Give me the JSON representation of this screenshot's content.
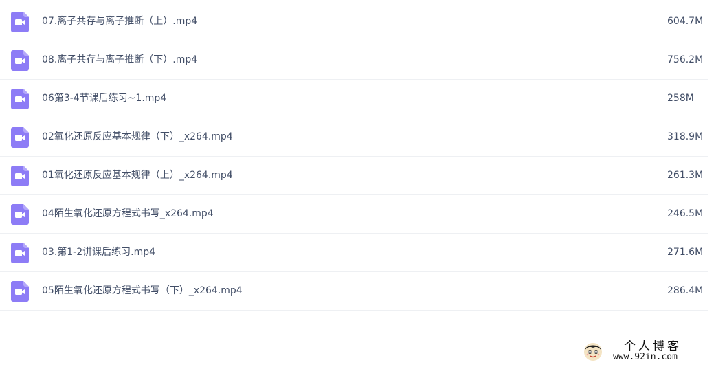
{
  "files": [
    {
      "name": "07.离子共存与离子推断（上）.mp4",
      "size": "604.7M",
      "icon": "video-file-icon"
    },
    {
      "name": "08.离子共存与离子推断（下）.mp4",
      "size": "756.2M",
      "icon": "video-file-icon"
    },
    {
      "name": "06第3-4节课后练习~1.mp4",
      "size": "258M",
      "icon": "video-file-icon"
    },
    {
      "name": "02氧化还原反应基本规律（下）_x264.mp4",
      "size": "318.9M",
      "icon": "video-file-icon"
    },
    {
      "name": "01氧化还原反应基本规律（上）_x264.mp4",
      "size": "261.3M",
      "icon": "video-file-icon"
    },
    {
      "name": "04陌生氧化还原方程式书写_x264.mp4",
      "size": "246.5M",
      "icon": "video-file-icon"
    },
    {
      "name": "03.第1-2讲课后练习.mp4",
      "size": "271.6M",
      "icon": "video-file-icon"
    },
    {
      "name": "05陌生氧化还原方程式书写（下）_x264.mp4",
      "size": "286.4M",
      "icon": "video-file-icon"
    }
  ],
  "watermark": {
    "title": "个人博客",
    "url": "www.92in.com"
  },
  "colors": {
    "icon": "#8d7cf6",
    "text": "#424e67",
    "divider": "#eef0f3"
  }
}
